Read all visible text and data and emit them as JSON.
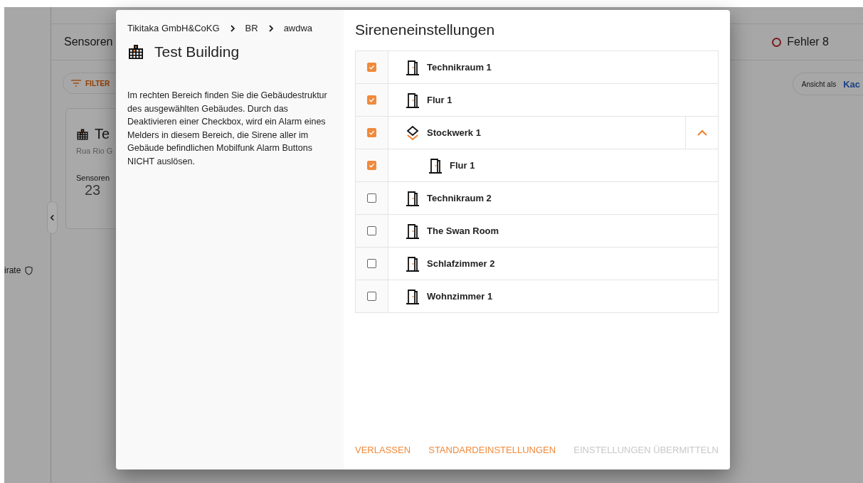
{
  "background": {
    "header": {
      "sensors_label": "Sensoren",
      "error_label": "Fehler 8"
    },
    "filter_button": "FILTER",
    "view_toggle": {
      "label": "Ansicht als",
      "value": "Kac"
    },
    "card": {
      "title": "Te",
      "address": "Rua Rio G",
      "sensors_label": "Sensoren",
      "sensors_value": "23"
    },
    "sidebar_item": "irate"
  },
  "dialog": {
    "breadcrumb": [
      "Tikitaka GmbH&CoKG",
      "BR",
      "awdwa"
    ],
    "building_name": "Test Building",
    "description": "Im rechten Bereich finden Sie die Gebäudestruktur des ausgewählten Gebäudes. Durch das Deaktivieren einer Checkbox, wird ein Alarm eines Melders in diesem Bereich, die Sirene aller im Gebäude befindlichen Mobilfunk Alarm Buttons NICHT auslösen.",
    "title": "Sireneneinstellungen",
    "areas": [
      {
        "kind": "room",
        "name": "Technikraum 1",
        "checked": true
      },
      {
        "kind": "room",
        "name": "Flur 1",
        "checked": true
      },
      {
        "kind": "floor",
        "name": "Stockwerk 1",
        "checked": true,
        "expanded": true,
        "children": [
          {
            "kind": "room",
            "name": "Flur 1",
            "checked": true
          }
        ]
      },
      {
        "kind": "room",
        "name": "Technikraum 2",
        "checked": false
      },
      {
        "kind": "room",
        "name": "The Swan Room",
        "checked": false
      },
      {
        "kind": "room",
        "name": "Schlafzimmer 2",
        "checked": false
      },
      {
        "kind": "room",
        "name": "Wohnzimmer 1",
        "checked": false
      }
    ],
    "buttons": [
      {
        "label": "VERLASSEN",
        "disabled": false
      },
      {
        "label": "STANDARDEINSTELLUNGEN",
        "disabled": false
      },
      {
        "label": "EINSTELLUNGEN ÜBERMITTELN",
        "disabled": true
      }
    ]
  }
}
